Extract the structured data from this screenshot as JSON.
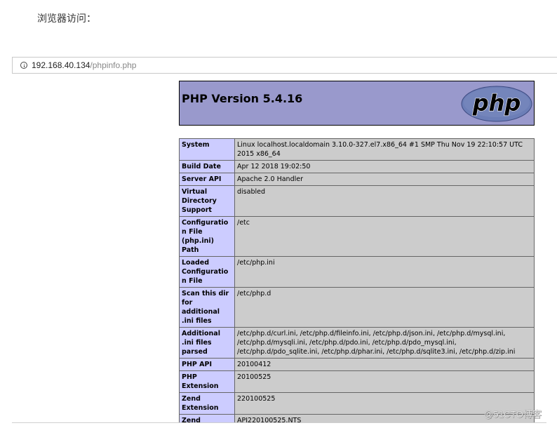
{
  "caption": "浏览器访问：",
  "address_bar": {
    "host": "192.168.40.134",
    "path": "/phpinfo.php"
  },
  "phpinfo": {
    "header_title": "PHP Version 5.4.16",
    "logo_text": "php",
    "rows": [
      {
        "label": "System",
        "value": "Linux localhost.localdomain 3.10.0-327.el7.x86_64 #1 SMP Thu Nov 19 22:10:57 UTC 2015 x86_64"
      },
      {
        "label": "Build Date",
        "value": "Apr 12 2018 19:02:50"
      },
      {
        "label": "Server API",
        "value": "Apache 2.0 Handler"
      },
      {
        "label": "Virtual Directory Support",
        "value": "disabled"
      },
      {
        "label": "Configuration File (php.ini) Path",
        "value": "/etc"
      },
      {
        "label": "Loaded Configuration File",
        "value": "/etc/php.ini"
      },
      {
        "label": "Scan this dir for additional .ini files",
        "value": "/etc/php.d"
      },
      {
        "label": "Additional .ini files parsed",
        "value": "/etc/php.d/curl.ini, /etc/php.d/fileinfo.ini, /etc/php.d/json.ini, /etc/php.d/mysql.ini, /etc/php.d/mysqli.ini, /etc/php.d/pdo.ini, /etc/php.d/pdo_mysql.ini, /etc/php.d/pdo_sqlite.ini, /etc/php.d/phar.ini, /etc/php.d/sqlite3.ini, /etc/php.d/zip.ini"
      },
      {
        "label": "PHP API",
        "value": "20100412"
      },
      {
        "label": "PHP Extension",
        "value": "20100525"
      },
      {
        "label": "Zend Extension",
        "value": "220100525"
      },
      {
        "label": "Zend",
        "value": "API220100525,NTS"
      }
    ]
  },
  "watermark": "@51CTO博客",
  "colors": {
    "header_bg": "#9999cc",
    "label_bg": "#ccccff",
    "value_bg": "#cccccc",
    "logo_fill": "#6c7eb7"
  }
}
